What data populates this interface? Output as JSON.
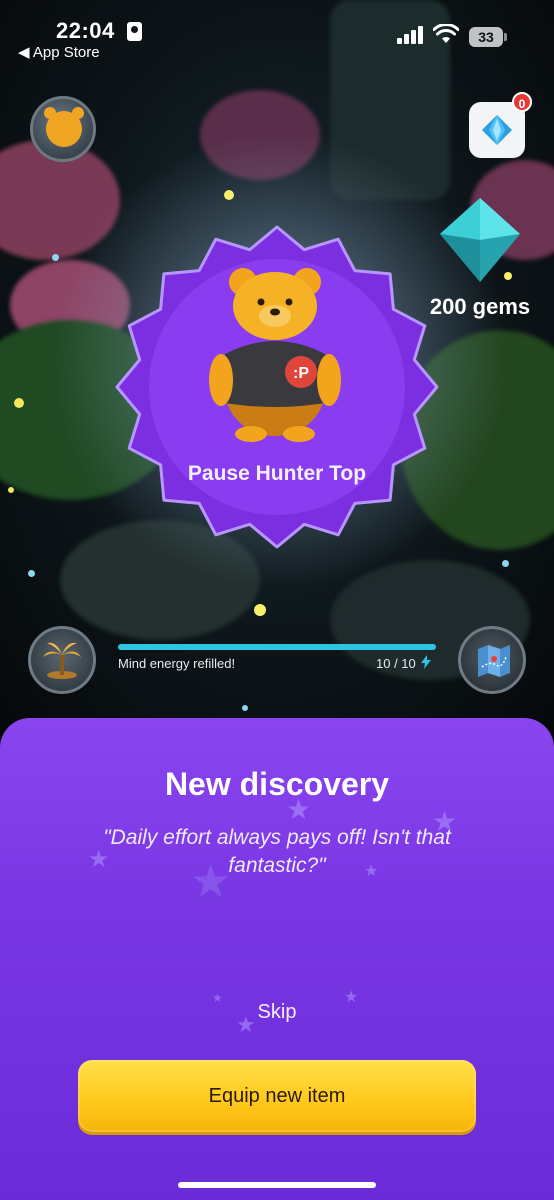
{
  "status_bar": {
    "time": "22:04",
    "back_label": "◀ App Store",
    "battery_level": "33"
  },
  "hud": {
    "notification_count": "0",
    "gem_reward_label": "200 gems"
  },
  "discovery_item": {
    "name": "Pause Hunter Top",
    "shirt_logo": ":P"
  },
  "energy": {
    "label": "Mind energy refilled!",
    "count": "10 / 10",
    "current": 10,
    "max": 10
  },
  "sheet": {
    "title": "New discovery",
    "quote": "\"Daily effort always pays off! Isn't that fantastic?\"",
    "skip_label": "Skip",
    "equip_label": "Equip new item"
  },
  "colors": {
    "sheet_purple": "#7a38e4",
    "badge_purple": "#7b2fe0",
    "equip_yellow": "#ffc81a",
    "energy_cyan": "#2ec4e6",
    "gem_teal": "#3ed0d6",
    "badge_red": "#e53935"
  },
  "icons": [
    "profile-avatar-icon",
    "gem-icon",
    "gem-reward-icon",
    "palm-tree-icon",
    "map-icon",
    "lightning-bolt-icon",
    "signal-icon",
    "wifi-icon",
    "battery-icon",
    "contact-card-icon"
  ]
}
